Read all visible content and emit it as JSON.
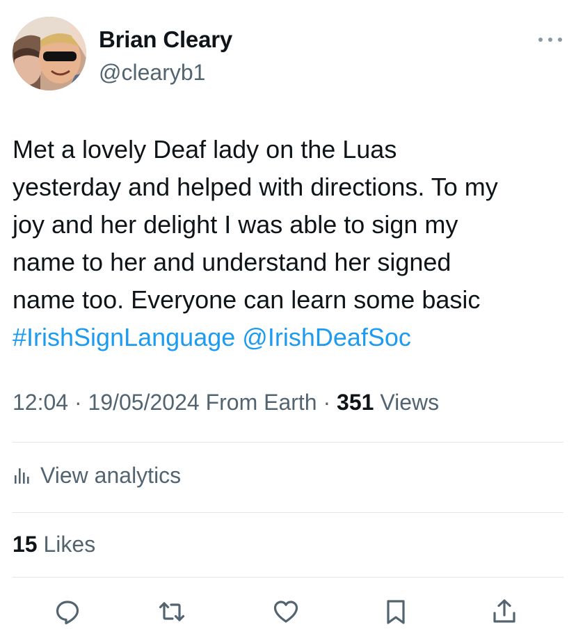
{
  "tweet": {
    "author": {
      "name": "Brian Cleary",
      "handle": "@clearyb1"
    },
    "text_segments": {
      "line1": "Met a lovely Deaf lady on the Luas",
      "line2": "yesterday and helped with directions. To my",
      "line3": "joy and her delight I was able to sign my",
      "line4": "name to her and understand her signed",
      "line5": "name too. Everyone can learn some basic",
      "hashtag": "#IrishSignLanguage",
      "mention": "@IrishDeafSoc"
    },
    "meta": {
      "time": "12:04",
      "separator1": " · ",
      "date": "19/05/2024",
      "source": " From Earth",
      "separator2": " · ",
      "views_count": "351",
      "views_label": " Views"
    },
    "analytics_label": "View analytics",
    "likes": {
      "count": "15",
      "label": " Likes"
    }
  },
  "actions": [
    {
      "name": "reply",
      "icon": "reply-icon"
    },
    {
      "name": "retweet",
      "icon": "retweet-icon"
    },
    {
      "name": "like",
      "icon": "heart-icon"
    },
    {
      "name": "bookmark",
      "icon": "bookmark-icon"
    },
    {
      "name": "share",
      "icon": "share-icon"
    }
  ],
  "colors": {
    "text": "#0f1419",
    "secondary": "#536471",
    "link": "#1d9bf0",
    "divider": "#e1e6ea",
    "icon": "#536471"
  }
}
